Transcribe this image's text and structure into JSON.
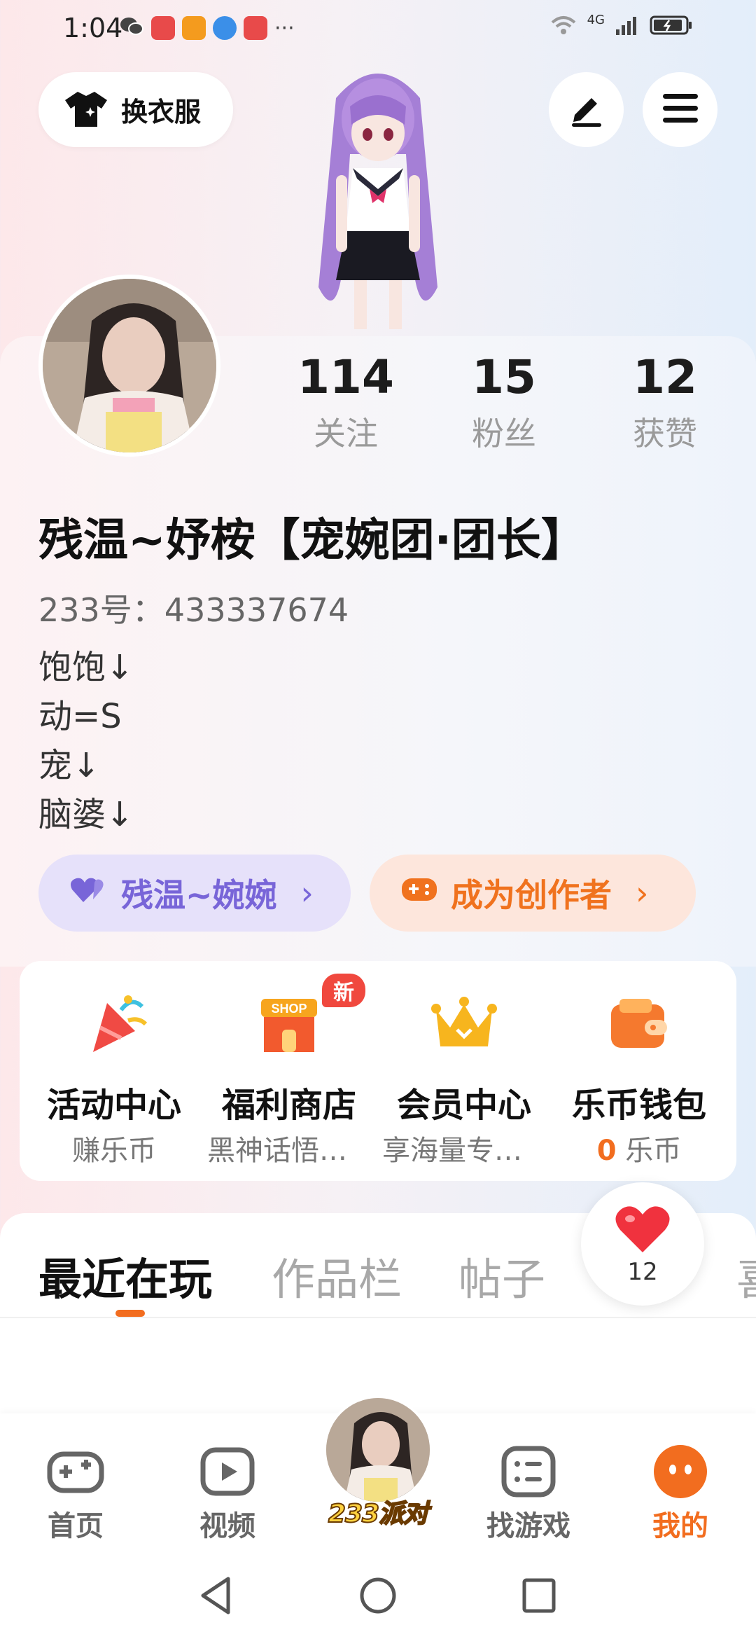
{
  "status_bar": {
    "time": "1:04",
    "network": "4G",
    "dots": "···"
  },
  "top_actions": {
    "outfit_label": "换衣服"
  },
  "profile": {
    "stats": [
      {
        "value": "114",
        "label": "关注"
      },
      {
        "value": "15",
        "label": "粉丝"
      },
      {
        "value": "12",
        "label": "获赞"
      }
    ],
    "nickname": "残温~妤桉【宠婉团·团长】",
    "uid": "233号：433337674",
    "bio": [
      "饱饱↓",
      "动=S",
      "宠↓",
      "脑婆↓"
    ],
    "family_tag": "残温~婉婉",
    "creator_tag": "成为创作者",
    "chevron": "›"
  },
  "functions": [
    {
      "title": "活动中心",
      "sub": "赚乐币",
      "icon": "party-popper-icon"
    },
    {
      "title": "福利商店",
      "sub": "黑神话悟空…",
      "icon": "shop-icon",
      "badge": "新",
      "shop_text": "SHOP"
    },
    {
      "title": "会员中心",
      "sub": "享海量专属…",
      "icon": "crown-icon"
    },
    {
      "title": "乐币钱包",
      "sub_num": "0",
      "sub": "乐币",
      "icon": "wallet-icon"
    }
  ],
  "tabs": [
    "最近在玩",
    "作品栏",
    "帖子",
    "喜"
  ],
  "like_fab": {
    "count": "12"
  },
  "bottom_nav": {
    "home": "首页",
    "video": "视频",
    "party": "233派对",
    "find_game": "找游戏",
    "mine": "我的"
  },
  "colors": {
    "accent": "#f26d1f",
    "family_purple": "#7865d8",
    "creator_orange": "#f0721e"
  }
}
